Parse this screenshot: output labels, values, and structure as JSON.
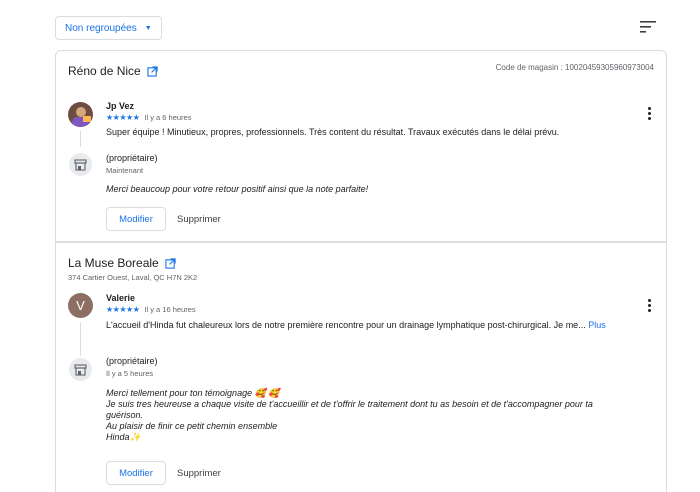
{
  "toolbar": {
    "filter_label": "Non regroupées",
    "sort_icon": "sort-icon"
  },
  "reviews": [
    {
      "business_name": "Réno de Nice",
      "store_code": "Code de magasin : 10020459305960973004",
      "address": "",
      "author": "Jp Vez",
      "stars": "★★★★★",
      "time": "Il y a 6 heures",
      "text": "Super équipe ! Minutieux, propres, professionnels. Très content du résultat. Travaux exécutés dans le délai prévu.",
      "more": "",
      "owner_label": "(propriétaire)",
      "owner_time": "Maintenant",
      "reply": "Merci beaucoup pour votre retour positif ainsi que la note parfaite!",
      "modify_label": "Modifier",
      "delete_label": "Supprimer"
    },
    {
      "business_name": "La Muse Boreale",
      "store_code": "",
      "address": "374 Cartier Ouest, Laval, QC H7N 2K2",
      "author": "Valerie",
      "avatar_letter": "V",
      "stars": "★★★★★",
      "time": "Il y a 16 heures",
      "text": "L'accueil d'Hinda fut chaleureux lors de notre première rencontre pour un drainage lymphatique post-chirurgical. Je me...",
      "more": "Plus",
      "owner_label": "(propriétaire)",
      "owner_time": "Il y a 5 heures",
      "reply": "Merci tellement pour ton témoignage 🥰 🥰\nJe suis tres heureuse a chaque visite de t'accueillir et de t'offrir le traitement dont tu as besoin et de t'accompagner pour ta guérison.\nAu plaisir de finir ce petit chemin ensemble\nHinda✨",
      "modify_label": "Modifier",
      "delete_label": "Supprimer"
    }
  ],
  "colors": {
    "accent": "#1a73e8",
    "text": "#202124",
    "muted": "#5f6368",
    "border": "#dadce0"
  }
}
